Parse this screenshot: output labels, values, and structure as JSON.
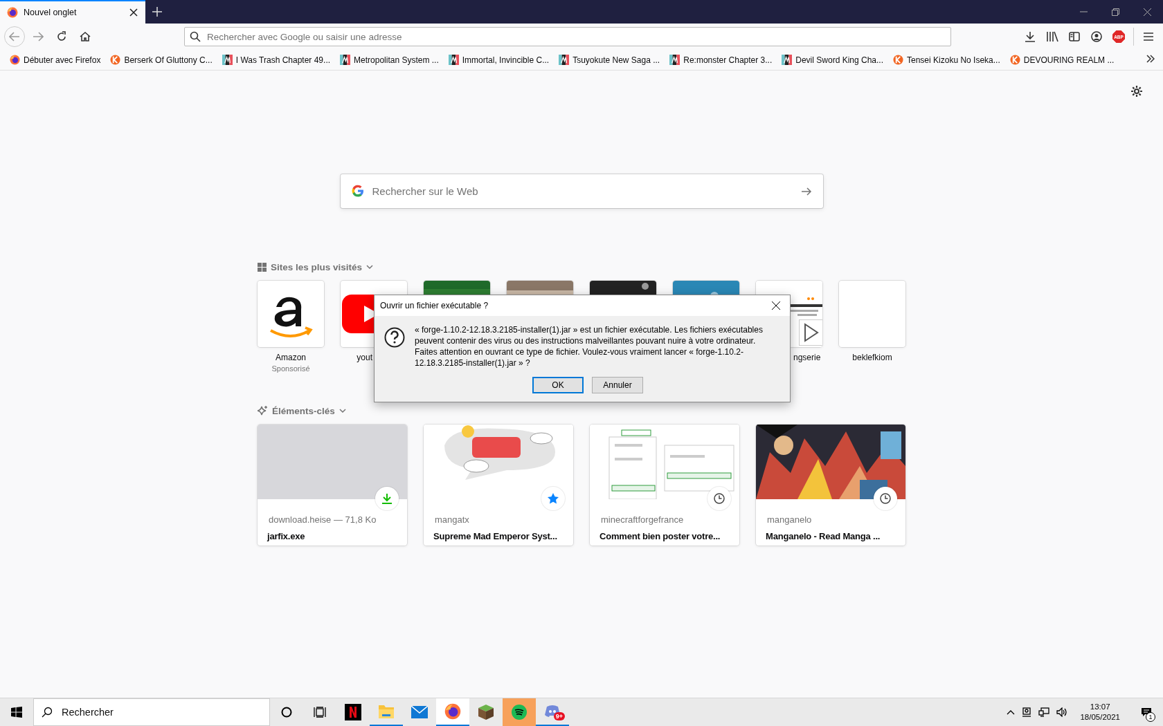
{
  "browser": {
    "tabs": [
      {
        "label": "Nouvel onglet",
        "selected": true
      }
    ],
    "address_bar": {
      "placeholder": "Rechercher avec Google ou saisir une adresse"
    },
    "adblock_label": "ABP",
    "bookmarks": [
      {
        "label": "Débuter avec Firefox",
        "kind": "firefox"
      },
      {
        "label": "Berserk Of Gluttony C...",
        "kind": "orange"
      },
      {
        "label": "I Was Trash Chapter 49...",
        "kind": "manga"
      },
      {
        "label": "Metropolitan System ...",
        "kind": "manga"
      },
      {
        "label": "Immortal, Invincible C...",
        "kind": "manga"
      },
      {
        "label": "Tsuyokute New Saga ...",
        "kind": "manga"
      },
      {
        "label": "Re:monster Chapter 3...",
        "kind": "manga"
      },
      {
        "label": "Devil Sword King Cha...",
        "kind": "manga"
      },
      {
        "label": "Tensei Kizoku No Iseka...",
        "kind": "orange"
      },
      {
        "label": "DEVOURING REALM ...",
        "kind": "orange"
      }
    ]
  },
  "new_tab": {
    "search": {
      "placeholder": "Rechercher sur le Web"
    },
    "top_sites": {
      "title": "Sites les plus visités",
      "tiles": [
        {
          "label": "Amazon",
          "sponsor": "Sponsorisé",
          "kind": "amazon"
        },
        {
          "label": "yout",
          "kind": "youtube"
        },
        {
          "kind": "picture"
        },
        {
          "kind": "picture"
        },
        {
          "kind": "picture"
        },
        {
          "kind": "picture"
        },
        {
          "label": "ngserie",
          "kind": "page"
        },
        {
          "label": "beklefkiom",
          "kind": "blank"
        }
      ]
    },
    "highlights": {
      "title": "Éléments-clés",
      "cards": [
        {
          "source": "download.heise — 71,8 Ko",
          "title": "jarfix.exe",
          "kind": "download"
        },
        {
          "source": "mangatx",
          "title": "Supreme Mad Emperor Syst...",
          "kind": "bookmark"
        },
        {
          "source": "minecraftforgefrance",
          "title": "Comment bien poster votre...",
          "kind": "history"
        },
        {
          "source": "manganelo",
          "title": "Manganelo - Read Manga ...",
          "kind": "history"
        }
      ]
    }
  },
  "dialog": {
    "title": "Ouvrir un fichier exécutable ?",
    "message": "« forge-1.10.2-12.18.3.2185-installer(1).jar » est un fichier exécutable. Les fichiers exécutables peuvent contenir des virus ou des instructions malveillantes pouvant nuire à votre ordinateur. Faites attention en ouvrant ce type de fichier. Voulez-vous vraiment lancer « forge-1.10.2-12.18.3.2185-installer(1).jar » ?",
    "buttons": [
      {
        "label": "OK",
        "default": true
      },
      {
        "label": "Annuler",
        "default": false
      }
    ]
  },
  "taskbar": {
    "search": {
      "placeholder": "Rechercher"
    },
    "apps": [
      {
        "kind": "netflix",
        "running": false,
        "focused": false,
        "flashing": false
      },
      {
        "kind": "explorer",
        "running": true,
        "focused": false,
        "flashing": false
      },
      {
        "kind": "mail",
        "running": false,
        "focused": false,
        "flashing": false
      },
      {
        "kind": "firefox",
        "running": true,
        "focused": true,
        "flashing": false
      },
      {
        "kind": "minecraft",
        "running": false,
        "focused": false,
        "flashing": false
      },
      {
        "kind": "spotify",
        "running": false,
        "focused": false,
        "flashing": true
      },
      {
        "kind": "discord",
        "running": true,
        "focused": false,
        "flashing": false,
        "badge": "9+"
      }
    ],
    "time": "13:07",
    "date": "18/05/2021",
    "notifications": "1"
  }
}
